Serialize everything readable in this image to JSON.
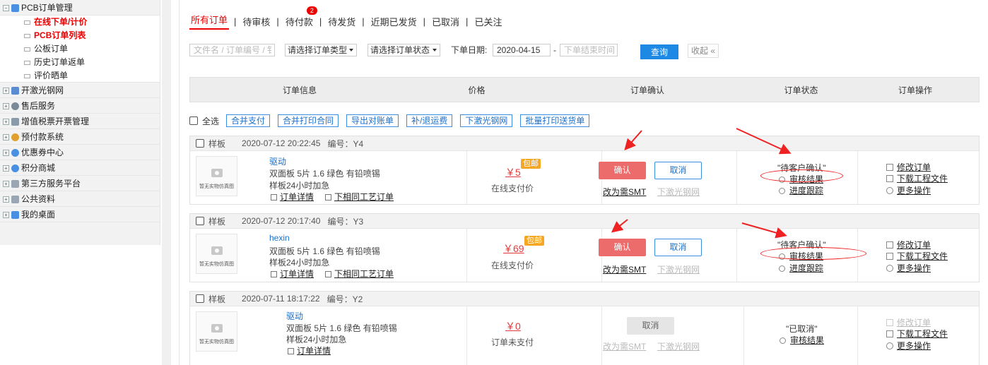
{
  "sidebar": {
    "group_pcb": "PCB订单管理",
    "sub_items": [
      "在线下单/计价",
      "PCB订单列表",
      "公板订单",
      "历史订单返单",
      "评价晒单"
    ],
    "groups": [
      "开激光钢网",
      "售后服务",
      "增值税票开票管理",
      "预付款系统",
      "优惠券中心",
      "积分商城",
      "第三方服务平台",
      "公共资料",
      "我的桌面"
    ]
  },
  "tabs": {
    "items": [
      "所有订单",
      "待审核",
      "待付款",
      "待发货",
      "近期已发货",
      "已取消",
      "已关注"
    ],
    "badge_count": "2"
  },
  "filters": {
    "keyword_placeholder": "文件名 / 订单编号 / 钅",
    "type_select": "请选择订单类型",
    "status_select": "请选择订单状态",
    "date_label": "下单日期:",
    "date_start": "2020-04-15",
    "dash": "-",
    "date_end_placeholder": "下单结束时间",
    "search_label": "查询",
    "collapse_label": "收起"
  },
  "table_header": [
    "订单信息",
    "价格",
    "订单确认",
    "订单状态",
    "订单操作"
  ],
  "bulk": {
    "select_all": "全选",
    "buttons": [
      "合并支付",
      "合并打印合同",
      "导出对账单",
      "补/退运费",
      "下激光钢网",
      "批量打印送货单"
    ]
  },
  "common": {
    "thumb_caption": "暂无实物仿真图",
    "order_detail": "订单详情",
    "same_process": "下相同工艺订单",
    "confirm": "确认",
    "cancel": "取消",
    "smt": "改为需SMT",
    "laser": "下激光钢网",
    "audit_result": "审核结果",
    "progress": "进度跟踪",
    "modify": "修改订单",
    "download": "下载工程文件",
    "more": "更多操作",
    "baoyou": "包邮"
  },
  "orders": [
    {
      "type": "样板",
      "date": "2020-07-12 20:22:45",
      "no": "编号：Y4",
      "name": "驱动",
      "spec": "双面板   5片   1.6   绿色   有铅喷锡",
      "urgent": "样板24小时加急",
      "price": "￥5",
      "pay": "在线支付价",
      "status": "\"待客户确认\""
    },
    {
      "type": "样板",
      "date": "2020-07-12 20:17:40",
      "no": "编号：Y3",
      "name": "hexin",
      "spec": "双面板   5片   1.6   绿色   有铅喷锡",
      "urgent": "样板24小时加急",
      "price": "￥69",
      "pay": "在线支付价",
      "status": "\"待客户确认\""
    },
    {
      "type": "样板",
      "date": "2020-07-11 18:17:22",
      "no": "编号：Y2",
      "name": "驱动",
      "spec": "双面板   5片   1.6   绿色   有铅喷锡",
      "urgent": "样板24小时加急",
      "price": "￥0",
      "pay": "订单未支付",
      "status": "\"已取消\""
    }
  ],
  "colors": {
    "accent_red": "#e00000",
    "link_blue": "#1e70c8",
    "confirm_red": "#ec6b6b",
    "search_blue": "#1e88e5",
    "tag_orange": "#f5a623"
  }
}
